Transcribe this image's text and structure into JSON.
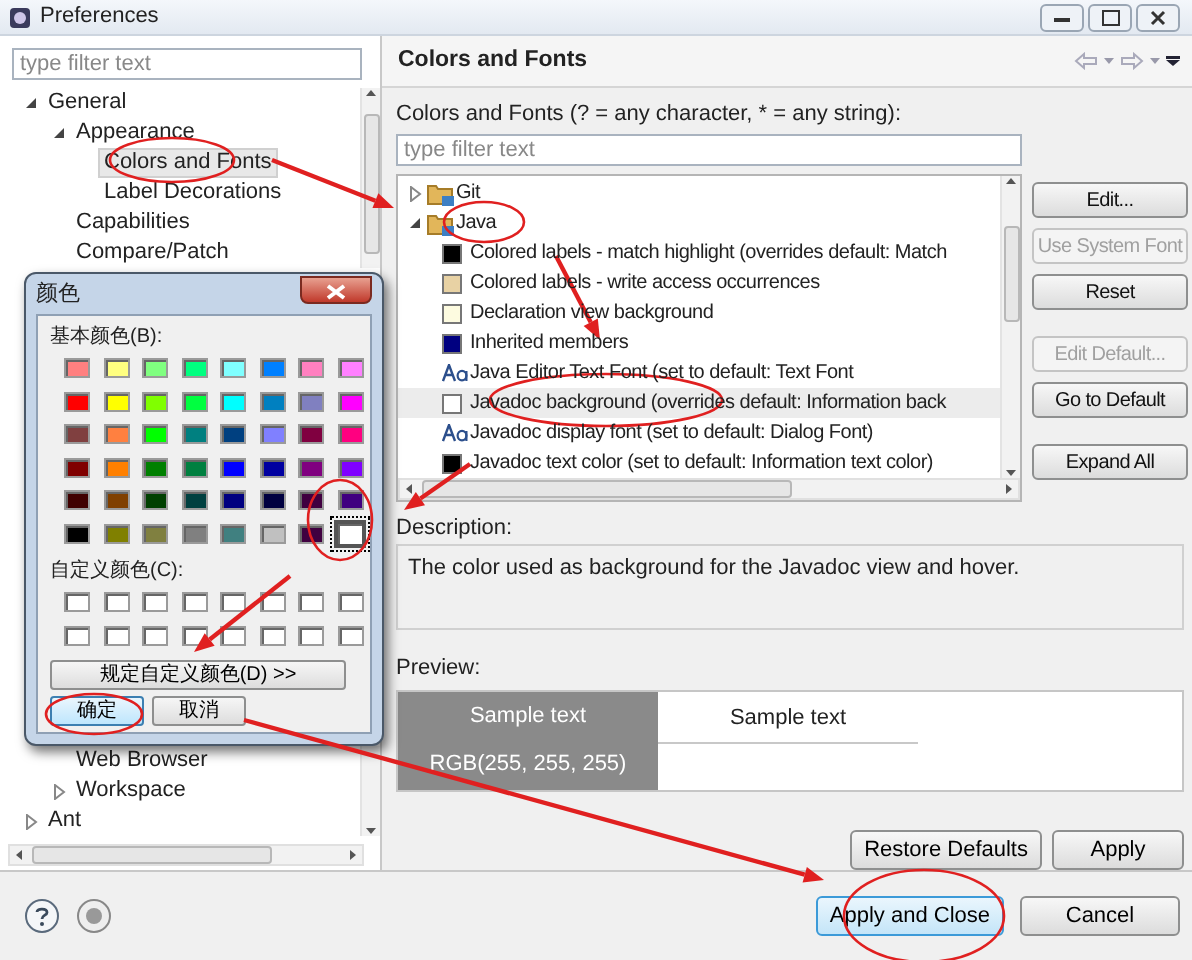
{
  "window": {
    "title": "Preferences"
  },
  "left_filter": {
    "placeholder": "type filter text"
  },
  "nav_tree": [
    {
      "label": "General",
      "expanded": true,
      "selected": false,
      "children": [
        {
          "label": "Appearance",
          "expanded": true,
          "selected": false,
          "children": [
            {
              "label": "Colors and Fonts",
              "selected": true
            },
            {
              "label": "Label Decorations",
              "selected": false
            }
          ]
        },
        {
          "label": "Capabilities",
          "selected": false
        },
        {
          "label": "Compare/Patch",
          "selected": false
        },
        {
          "label": "Web Browser",
          "selected": false
        },
        {
          "label": "Workspace",
          "expanded": false,
          "selected": false
        }
      ]
    },
    {
      "label": "Ant",
      "expanded": false,
      "selected": false
    }
  ],
  "color_dialog": {
    "title": "颜色",
    "basic_label": "基本颜色(B):",
    "basic_colors": [
      {
        "color": "#ff8080",
        "selected": false
      },
      {
        "color": "#ffff80",
        "selected": false
      },
      {
        "color": "#80ff80",
        "selected": false
      },
      {
        "color": "#00ff80",
        "selected": false
      },
      {
        "color": "#80ffff",
        "selected": false
      },
      {
        "color": "#0080ff",
        "selected": false
      },
      {
        "color": "#ff80c0",
        "selected": false
      },
      {
        "color": "#ff80ff",
        "selected": false
      },
      {
        "color": "#ff0000",
        "selected": false
      },
      {
        "color": "#ffff00",
        "selected": false
      },
      {
        "color": "#80ff00",
        "selected": false
      },
      {
        "color": "#00ff40",
        "selected": false
      },
      {
        "color": "#00ffff",
        "selected": false
      },
      {
        "color": "#0080c0",
        "selected": false
      },
      {
        "color": "#8080c0",
        "selected": false
      },
      {
        "color": "#ff00ff",
        "selected": false
      },
      {
        "color": "#804040",
        "selected": false
      },
      {
        "color": "#ff8040",
        "selected": false
      },
      {
        "color": "#00ff00",
        "selected": false
      },
      {
        "color": "#008080",
        "selected": false
      },
      {
        "color": "#004080",
        "selected": false
      },
      {
        "color": "#8080ff",
        "selected": false
      },
      {
        "color": "#800040",
        "selected": false
      },
      {
        "color": "#ff0080",
        "selected": false
      },
      {
        "color": "#800000",
        "selected": false
      },
      {
        "color": "#ff8000",
        "selected": false
      },
      {
        "color": "#008000",
        "selected": false
      },
      {
        "color": "#008040",
        "selected": false
      },
      {
        "color": "#0000ff",
        "selected": false
      },
      {
        "color": "#0000a0",
        "selected": false
      },
      {
        "color": "#800080",
        "selected": false
      },
      {
        "color": "#8000ff",
        "selected": false
      },
      {
        "color": "#400000",
        "selected": false
      },
      {
        "color": "#804000",
        "selected": false
      },
      {
        "color": "#004000",
        "selected": false
      },
      {
        "color": "#004040",
        "selected": false
      },
      {
        "color": "#000080",
        "selected": false
      },
      {
        "color": "#000040",
        "selected": false
      },
      {
        "color": "#400040",
        "selected": false
      },
      {
        "color": "#400080",
        "selected": false
      },
      {
        "color": "#000000",
        "selected": false
      },
      {
        "color": "#808000",
        "selected": false
      },
      {
        "color": "#808040",
        "selected": false
      },
      {
        "color": "#808080",
        "selected": false
      },
      {
        "color": "#408080",
        "selected": false
      },
      {
        "color": "#c0c0c0",
        "selected": false
      },
      {
        "color": "#400040",
        "selected": false
      },
      {
        "color": "#ffffff",
        "selected": true
      }
    ],
    "custom_label": "自定义颜色(C):",
    "custom_colors": [
      {
        "color": "#ffffff"
      },
      {
        "color": "#ffffff"
      },
      {
        "color": "#ffffff"
      },
      {
        "color": "#ffffff"
      },
      {
        "color": "#ffffff"
      },
      {
        "color": "#ffffff"
      },
      {
        "color": "#ffffff"
      },
      {
        "color": "#ffffff"
      },
      {
        "color": "#ffffff"
      },
      {
        "color": "#ffffff"
      },
      {
        "color": "#ffffff"
      },
      {
        "color": "#ffffff"
      },
      {
        "color": "#ffffff"
      },
      {
        "color": "#ffffff"
      },
      {
        "color": "#ffffff"
      },
      {
        "color": "#ffffff"
      }
    ],
    "define_button": "规定自定义颜色(D) >>",
    "ok_button": "确定",
    "cancel_button": "取消"
  },
  "page": {
    "title": "Colors and Fonts",
    "filter_label": "Colors and Fonts (? = any character, * = any string):",
    "filter": {
      "placeholder": "type filter text"
    },
    "tree": [
      {
        "label": "Git",
        "kind": "folder",
        "expanded": false,
        "selected": false
      },
      {
        "label": "Java",
        "kind": "folder",
        "expanded": true,
        "selected": false,
        "children": [
          {
            "label": "Colored labels - match highlight (overrides default: Match",
            "kind": "color",
            "color": "#000000",
            "selected": false
          },
          {
            "label": "Colored labels - write access occurrences",
            "kind": "color",
            "color": "#e8d2a4",
            "selected": false
          },
          {
            "label": "Declaration view background",
            "kind": "color",
            "color": "#fdfbe0",
            "selected": false
          },
          {
            "label": "Inherited members",
            "kind": "color",
            "color": "#000080",
            "selected": false
          },
          {
            "label": "Java Editor Text Font (set to default: Text Font",
            "kind": "font",
            "selected": false
          },
          {
            "label": "Javadoc background (overrides default: Information back",
            "kind": "color",
            "color": "#ffffff",
            "selected": true
          },
          {
            "label": "Javadoc display font (set to default: Dialog Font)",
            "kind": "font",
            "selected": false
          },
          {
            "label": "Javadoc text color (set to default: Information text color)",
            "kind": "color",
            "color": "#000000",
            "selected": false
          }
        ]
      }
    ],
    "side_buttons": [
      {
        "label": "Edit...",
        "disabled": false
      },
      {
        "label": "Use System Font",
        "disabled": true
      },
      {
        "label": "Reset",
        "disabled": false
      },
      {
        "label": "Edit Default...",
        "disabled": true
      },
      {
        "label": "Go to Default",
        "disabled": false
      },
      {
        "label": "Expand All",
        "disabled": false
      }
    ],
    "description_label": "Description:",
    "description": "The color used as background for the Javadoc view and hover.",
    "preview_label": "Preview:",
    "preview": {
      "sample_on_color": "Sample text",
      "rgb": "RGB(255, 255, 255)",
      "sample_on_white": "Sample text"
    },
    "restore_button": "Restore Defaults",
    "apply_button": "Apply"
  },
  "footer": {
    "apply_close_button": "Apply and Close",
    "cancel_button": "Cancel"
  }
}
